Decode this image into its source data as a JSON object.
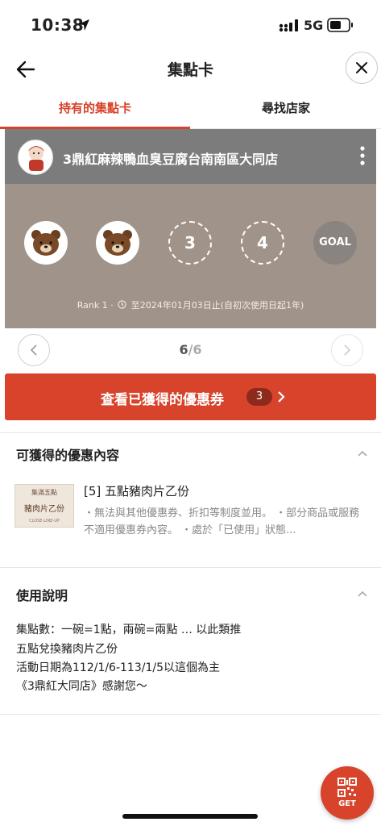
{
  "status_bar": {
    "time": "10:38",
    "network": "5G"
  },
  "nav": {
    "title": "集點卡"
  },
  "tabs": [
    {
      "label": "持有的集點卡",
      "active": true
    },
    {
      "label": "尋找店家",
      "active": false
    }
  ],
  "card": {
    "store_name": "3鼎紅麻辣鴨血臭豆腐台南南區大同店",
    "stamps": [
      {
        "state": "filled",
        "icon": "bear-stamp-icon",
        "label": ""
      },
      {
        "state": "filled",
        "icon": "bear-stamp-icon",
        "label": ""
      },
      {
        "state": "empty",
        "label": "3"
      },
      {
        "state": "empty",
        "label": "4"
      },
      {
        "state": "goal",
        "label": "GOAL"
      }
    ],
    "rank": "Rank 1 ·",
    "validity": "至2024年01月03日止(自初次使用日起1年)",
    "colors": {
      "body": "#a09389",
      "header": "#7c7c7c"
    }
  },
  "pager": {
    "current": "6",
    "total": "/6"
  },
  "coupon_button": {
    "label": "查看已獲得的優惠券",
    "count": "3"
  },
  "reward_section": {
    "title": "可獲得的優惠內容",
    "image": {
      "line1": "集滿五點",
      "line2": "豬肉片乙份",
      "line3": "CLOSE-LINE-UP"
    },
    "name": "[5] 五點豬肉片乙份",
    "description": "・無法與其他優惠券、折扣等制度並用。 ・部分商品或服務不適用優惠券內容。 ・處於「已使用」狀態..."
  },
  "usage_section": {
    "title": "使用說明",
    "lines": [
      "集點數：一碗=1點，兩碗=兩點 … 以此類推",
      "五點兌換豬肉片乙份",
      "活動日期為112/1/6-113/1/5以這個為主",
      "《3鼎紅大同店》感謝您～"
    ]
  },
  "fab": {
    "label": "GET"
  },
  "accent_color": "#d8432b"
}
